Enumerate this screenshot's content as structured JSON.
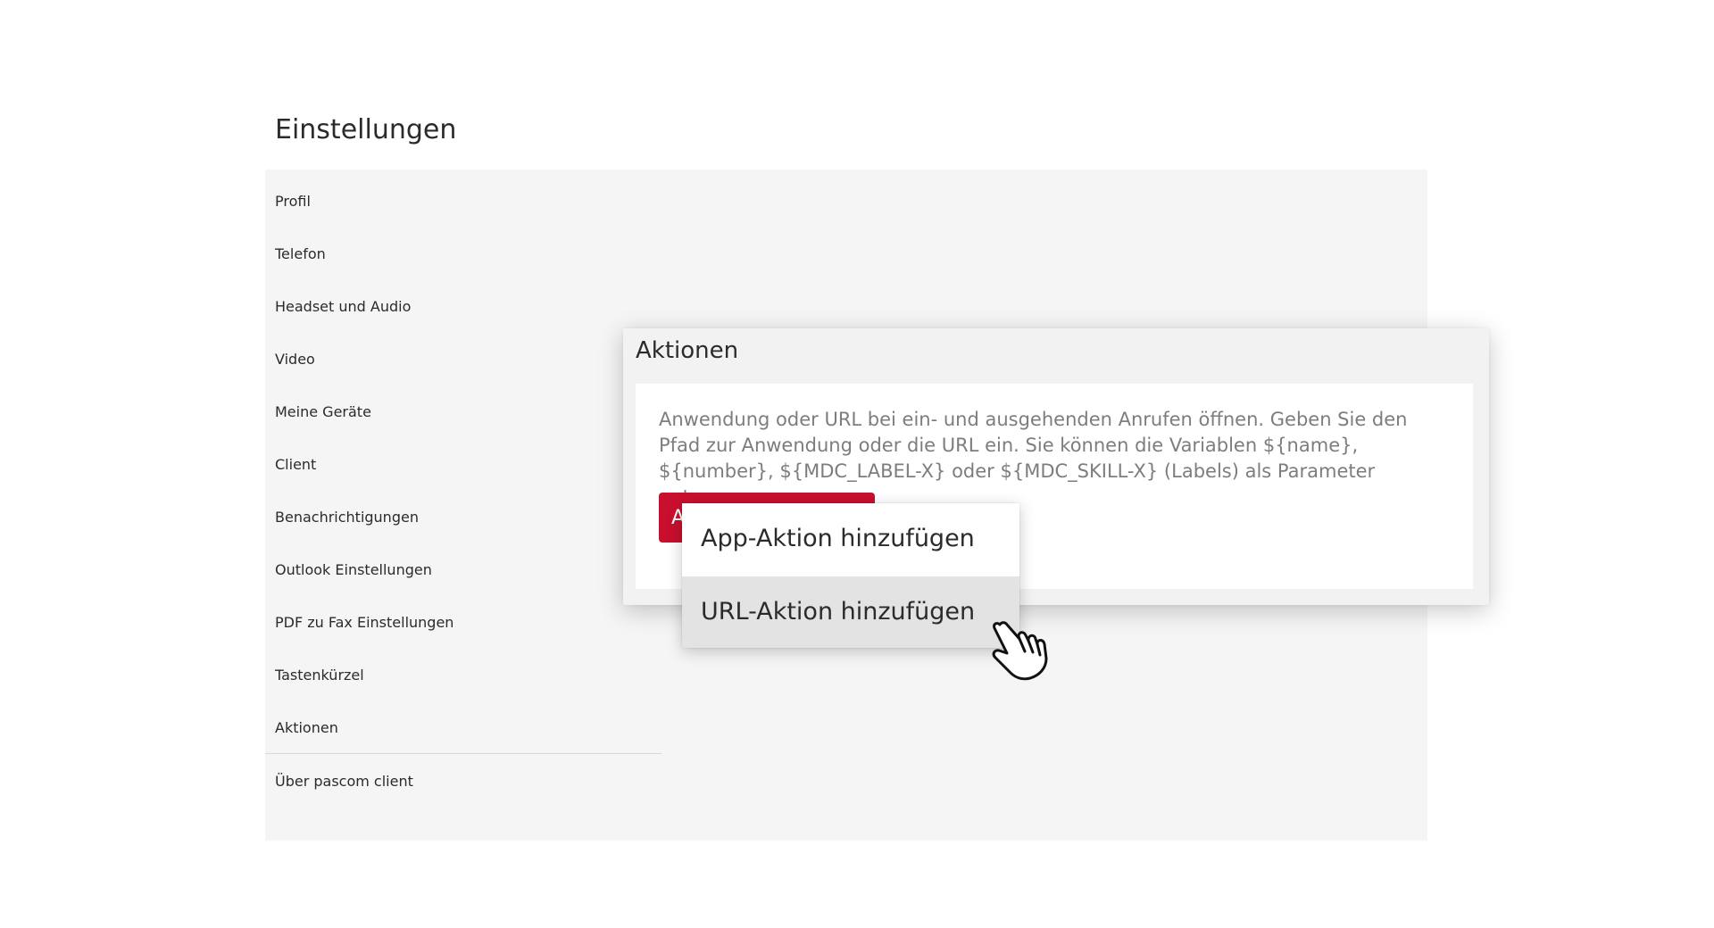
{
  "page": {
    "title": "Einstellungen"
  },
  "sidebar": {
    "items": [
      {
        "label": "Profil"
      },
      {
        "label": "Telefon"
      },
      {
        "label": "Headset und Audio"
      },
      {
        "label": "Video"
      },
      {
        "label": "Meine Geräte"
      },
      {
        "label": "Client"
      },
      {
        "label": "Benachrichtigungen"
      },
      {
        "label": "Outlook Einstellungen"
      },
      {
        "label": "PDF zu Fax Einstellungen"
      },
      {
        "label": "Tastenkürzel"
      },
      {
        "label": "Aktionen"
      },
      {
        "label": "Über pascom client"
      }
    ]
  },
  "actions_panel": {
    "title": "Aktionen",
    "description": "Anwendung oder URL bei ein- und ausgehenden Anrufen öffnen. Geben Sie den Pfad zur Anwendung oder die URL ein. Sie können die Variablen ${name}, ${number}, ${MDC_LABEL-X} oder ${MDC_SKILL-X} (Labels) als Parameter nutzen.",
    "add_button_label": "A"
  },
  "dropdown": {
    "items": [
      {
        "label": "App-Aktion hinzufügen"
      },
      {
        "label": "URL-Aktion hinzufügen"
      }
    ]
  },
  "colors": {
    "accent": "#c8102e",
    "panel_background": "#f5f5f5",
    "text": "#2b2b2b",
    "muted_text": "#7d7d7d",
    "menu_hover": "#e3e3e3"
  },
  "icons": {
    "cursor": "hand-pointer-icon"
  }
}
